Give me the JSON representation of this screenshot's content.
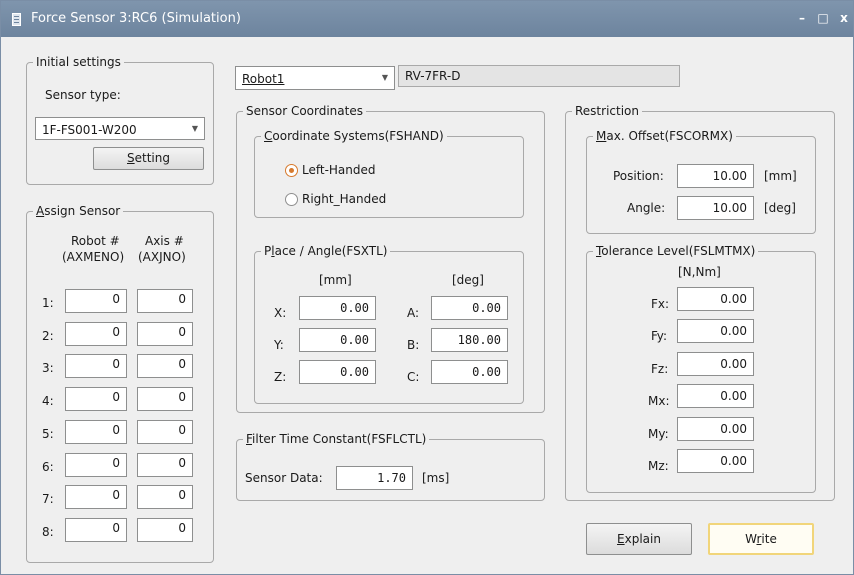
{
  "window": {
    "title": "Force Sensor 3:RC6  (Simulation)",
    "minimize": "–",
    "maximize": "□",
    "close": "x"
  },
  "initial_settings": {
    "legend": "Initial settings",
    "sensor_type_label": "Sensor type:",
    "sensor_type_value": "1F-FS001-W200",
    "setting_button_pre": "",
    "setting_button_ul": "S",
    "setting_button_post": "etting"
  },
  "assign_sensor": {
    "legend_ul": "A",
    "legend_post": "ssign Sensor",
    "col_robot": "Robot #",
    "col_robot_sub": "(AXMENO)",
    "col_axis": "Axis #",
    "col_axis_sub": "(AXJNO)",
    "rows": [
      {
        "label": "1:",
        "robot": "0",
        "axis": "0"
      },
      {
        "label": "2:",
        "robot": "0",
        "axis": "0"
      },
      {
        "label": "3:",
        "robot": "0",
        "axis": "0"
      },
      {
        "label": "4:",
        "robot": "0",
        "axis": "0"
      },
      {
        "label": "5:",
        "robot": "0",
        "axis": "0"
      },
      {
        "label": "6:",
        "robot": "0",
        "axis": "0"
      },
      {
        "label": "7:",
        "robot": "0",
        "axis": "0"
      },
      {
        "label": "8:",
        "robot": "0",
        "axis": "0"
      }
    ]
  },
  "robot": {
    "selected": "Robot1",
    "model": "RV-7FR-D"
  },
  "sensor_coordinates": {
    "legend": "Sensor Coordinates",
    "coord_systems": {
      "legend_ul": "C",
      "legend_post": "oordinate Systems(FSHAND)",
      "left": "Left-Handed",
      "right": "Right_Handed"
    },
    "place_angle": {
      "legend_pre": "P",
      "legend_ul": "l",
      "legend_post": "ace / Angle(FSXTL)",
      "unit_mm": "[mm]",
      "unit_deg": "[deg]",
      "x_label": "X:",
      "x": "0.00",
      "y_label": "Y:",
      "y": "0.00",
      "z_label": "Z:",
      "z": "0.00",
      "a_label": "A:",
      "a": "0.00",
      "b_label": "B:",
      "b": "180.00",
      "c_label": "C:",
      "c": "0.00"
    }
  },
  "filter": {
    "legend_ul": "F",
    "legend_post": "ilter Time Constant(FSFLCTL)",
    "label": "Sensor Data:",
    "value": "1.70",
    "unit": "[ms]"
  },
  "restriction": {
    "legend": "Restriction",
    "max_offset": {
      "legend_ul": "M",
      "legend_post": "ax. Offset(FSCORMX)",
      "position_label": "Position:",
      "position": "10.00",
      "position_unit": "[mm]",
      "angle_label": "Angle:",
      "angle": "10.00",
      "angle_unit": "[deg]"
    },
    "tolerance": {
      "legend_ul": "T",
      "legend_post": "olerance Level(FSLMTMX)",
      "unit": "[N,Nm]",
      "fx_label": "Fx:",
      "fx": "0.00",
      "fy_label": "Fy:",
      "fy": "0.00",
      "fz_label": "Fz:",
      "fz": "0.00",
      "mx_label": "Mx:",
      "mx": "0.00",
      "my_label": "My:",
      "my": "0.00",
      "mz_label": "Mz:",
      "mz": "0.00"
    }
  },
  "buttons": {
    "explain_ul": "E",
    "explain_post": "xplain",
    "write_pre": "W",
    "write_ul": "r",
    "write_post": "ite"
  }
}
